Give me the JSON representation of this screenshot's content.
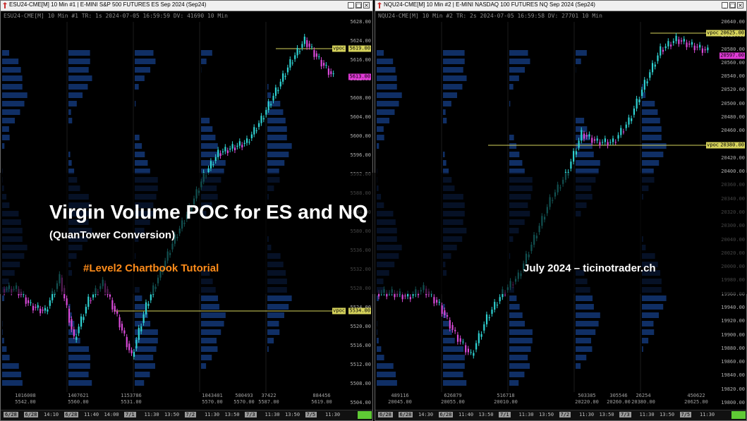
{
  "colors": {
    "up": "#2fd3d3",
    "down": "#d94ad9",
    "profile": "#1e56b8",
    "vpoc": "#d6d35c",
    "last_price": "#e03ad6",
    "titlebar": "#f0f0f0",
    "status_ok": "#5fc935"
  },
  "window_buttons": {
    "minimize": "_",
    "maximize": "□",
    "close": "×"
  },
  "overlay": {
    "title": "Virgin Volume POC for ES and NQ",
    "subtitle": "(QuanTower Conversion)",
    "tag": "#Level2 Chartbook Tutorial",
    "credit": "July 2024 – ticinotrader.ch"
  },
  "charts": [
    {
      "title": "ESU24-CME[M]  10 Min  #1 | E-MINI S&P 500 FUTURES ES Sep 2024 (Sep24)",
      "info": "ESU24-CME[M]  10 Min  #1  TR: 1s 2024-07-05 16:59:59  DV: 41690  10 Min",
      "price_ticks": [
        "5628.00",
        "5624.00",
        "5616.00",
        "5612.00",
        "5608.00",
        "5604.00",
        "5600.00",
        "5596.00",
        "5592.00",
        "5588.00",
        "5584.00",
        "5580.00",
        "5536.00",
        "5532.00",
        "5528.00",
        "5524.00",
        "5520.00",
        "5516.00",
        "5512.00",
        "5508.00",
        "5504.00"
      ],
      "vpoc_labels": [
        {
          "text": "vpoc",
          "price": "5619.00"
        },
        {
          "text": "vpoc",
          "price": "5534.00"
        }
      ],
      "last_price": "5613.00",
      "volumes": [
        {
          "vol": "1016008",
          "price": "5542.00"
        },
        {
          "vol": "1407621",
          "price": "5560.00"
        },
        {
          "vol": "1153786",
          "price": "5531.00"
        },
        {
          "vol": "1043401",
          "price": "5570.00"
        },
        {
          "vol": "580493",
          "price": "5570.00"
        },
        {
          "vol": "37422",
          "price": "5587.00"
        },
        {
          "vol": "884456",
          "price": "5619.00"
        }
      ],
      "time_labels": [
        "6/28",
        "6/28",
        "14:10",
        "6/28",
        "11:40",
        "14:00",
        "7/1",
        "11:30",
        "13:50",
        "7/2",
        "11:30",
        "13:50",
        "7/3",
        "11:30",
        "13:50",
        "7/5",
        "11:30"
      ],
      "chart_data": {
        "type": "candlestick",
        "series": [
          {
            "name": "ESU24",
            "close": [
              5538,
              5532,
              5530,
              5542,
              5520,
              5534,
              5540,
              5528,
              5514,
              5532,
              5544,
              5556,
              5566,
              5578,
              5586,
              5588,
              5590,
              5598,
              5608,
              5618,
              5626,
              5619,
              5613
            ]
          }
        ],
        "ylim": [
          5504,
          5630
        ]
      }
    },
    {
      "title": "NQU24-CME[M]  10 Min  #2 | E-MINI NASDAQ 100 FUTURES NQ Sep 2024 (Sep24)",
      "info": "NQU24-CME[M]  10 Min  #2  TR: 2s 2024-07-05 16:59:58  DV: 27701  10 Min",
      "price_ticks": [
        "20640.00",
        "20620.00",
        "20580.00",
        "20560.00",
        "20540.00",
        "20520.00",
        "20500.00",
        "20480.00",
        "20460.00",
        "20440.00",
        "20420.00",
        "20400.00",
        "20360.00",
        "20340.00",
        "20320.00",
        "20300.00",
        "20040.00",
        "20020.00",
        "20000.00",
        "19980.00",
        "19960.00",
        "19940.00",
        "19920.00",
        "19900.00",
        "19880.00",
        "19860.00",
        "19840.00",
        "19820.00",
        "19800.00"
      ],
      "vpoc_labels": [
        {
          "text": "vpoc",
          "price": "20625.00"
        },
        {
          "text": "vpoc",
          "price": "20380.00"
        }
      ],
      "last_price": "20597.00",
      "volumes": [
        {
          "vol": "489116",
          "price": "20045.00"
        },
        {
          "vol": "626879",
          "price": "20055.00"
        },
        {
          "vol": "516718",
          "price": "20010.00"
        },
        {
          "vol": "503385",
          "price": "20220.00"
        },
        {
          "vol": "305546",
          "price": "20260.00"
        },
        {
          "vol": "26254",
          "price": "20380.00"
        },
        {
          "vol": "450622",
          "price": "20625.00"
        }
      ],
      "time_labels": [
        "6/28",
        "6/28",
        "14:30",
        "6/28",
        "11:40",
        "13:50",
        "7/1",
        "11:30",
        "13:50",
        "7/2",
        "11:30",
        "13:50",
        "7/3",
        "11:30",
        "13:50",
        "7/5",
        "11:30"
      ],
      "chart_data": {
        "type": "candlestick",
        "series": [
          {
            "name": "NQU24",
            "close": [
              20020,
              20010,
              20030,
              19990,
              19920,
              19870,
              19960,
              20020,
              20060,
              20150,
              20240,
              20300,
              20400,
              20380,
              20380,
              20430,
              20520,
              20600,
              20625,
              20610,
              20597
            ]
          }
        ],
        "ylim": [
          19800,
          20650
        ]
      }
    }
  ]
}
